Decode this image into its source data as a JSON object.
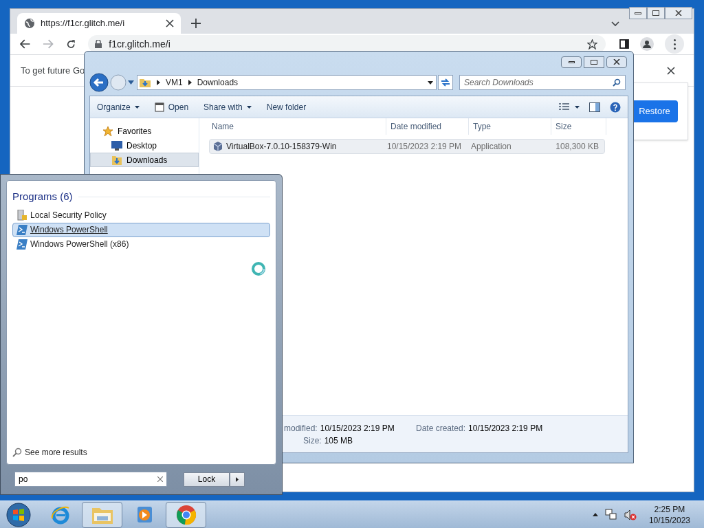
{
  "browser": {
    "tab": {
      "title": "https://f1cr.glitch.me/i"
    },
    "address": "f1cr.glitch.me/i",
    "infobar": {
      "text": "To get future Go"
    },
    "restore_button": "Restore"
  },
  "explorer": {
    "breadcrumb": [
      "VM1",
      "Downloads"
    ],
    "search": {
      "placeholder": "Search Downloads"
    },
    "toolbar": [
      {
        "label": "Organize",
        "kind": "menu"
      },
      {
        "label": "Open",
        "kind": "icon"
      },
      {
        "label": "Share with",
        "kind": "menu"
      },
      {
        "label": "New folder",
        "kind": "plain"
      }
    ],
    "nav": [
      {
        "label": "Favorites",
        "kind": "star",
        "selected": false,
        "children": [
          {
            "label": "Desktop",
            "kind": "desktop",
            "selected": false
          },
          {
            "label": "Downloads",
            "kind": "downloads",
            "selected": true
          }
        ]
      }
    ],
    "columns": [
      "Name",
      "Date modified",
      "Type",
      "Size"
    ],
    "files": [
      {
        "name": "VirtualBox-7.0.10-158379-Win",
        "date": "10/15/2023 2:19 PM",
        "type": "Application",
        "size": "108,300 KB",
        "selected": true
      }
    ],
    "details": [
      {
        "label": "modified:",
        "value": "10/15/2023 2:19 PM"
      },
      {
        "label": "Date created:",
        "value": "10/15/2023 2:19 PM"
      },
      {
        "label": "Size:",
        "value": "105 MB"
      }
    ]
  },
  "start_menu": {
    "group": "Programs (6)",
    "items": [
      {
        "label": "Local Security Policy",
        "kind": "policy",
        "selected": false
      },
      {
        "label": "Windows PowerShell",
        "kind": "shell",
        "selected": true
      },
      {
        "label": "Windows PowerShell (x86)",
        "kind": "shell",
        "selected": false
      }
    ],
    "see_more": "See more results",
    "search": {
      "value": "po"
    },
    "lock_button": "Lock"
  },
  "taskbar": {
    "apps": [
      {
        "kind": "ie",
        "active": false
      },
      {
        "kind": "explorer",
        "active": true
      },
      {
        "kind": "media",
        "active": false
      },
      {
        "kind": "chrome",
        "active": true
      }
    ],
    "time": "2:25 PM",
    "date": "10/15/2023"
  }
}
